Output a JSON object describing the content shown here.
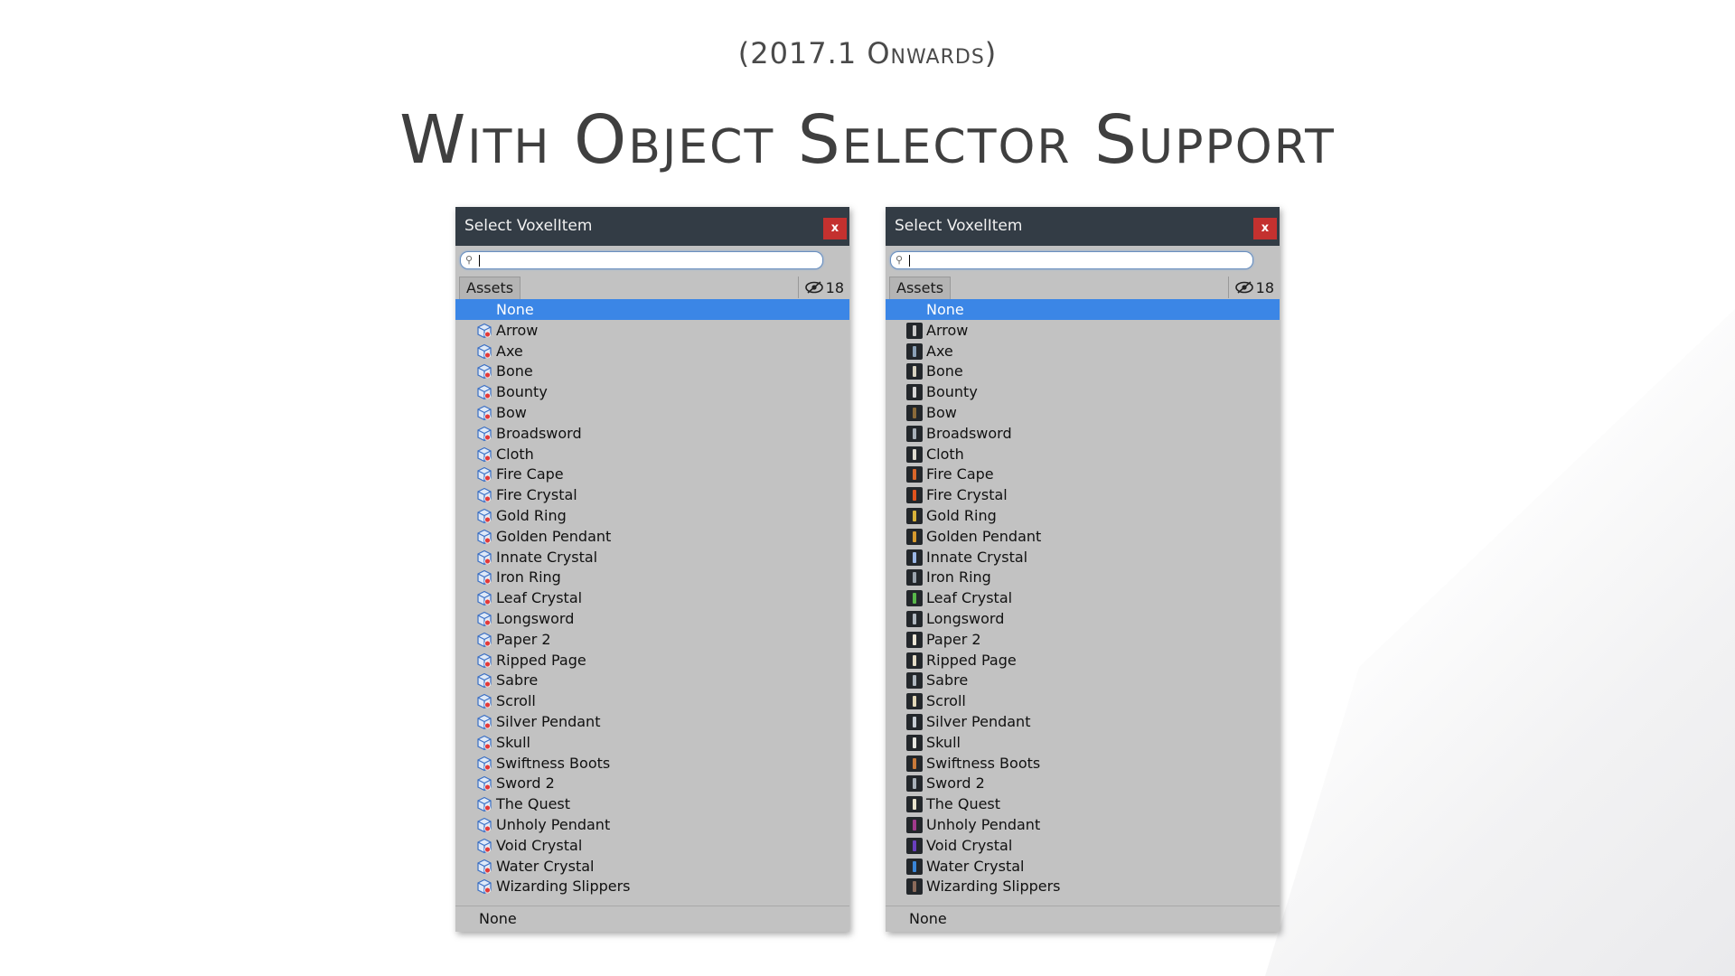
{
  "page": {
    "subtitle": "(2017.1 Onwards)",
    "title": "With Object Selector Support"
  },
  "colors": {
    "titlebar": "#333c45",
    "close_button": "#c4312f",
    "selection": "#3b86e6",
    "panel": "#c2c2c2"
  },
  "windows": [
    {
      "title": "Select VoxelItem",
      "close_label": "x",
      "search_value": "",
      "tab_label": "Assets",
      "hidden_count": "18",
      "icon_style": "prefab-cube-icon",
      "selected_label": "None"
    },
    {
      "title": "Select VoxelItem",
      "close_label": "x",
      "search_value": "",
      "tab_label": "Assets",
      "hidden_count": "18",
      "icon_style": "item-thumbnail-icon",
      "selected_label": "None"
    }
  ],
  "items": [
    {
      "label": "None",
      "thumb_color": ""
    },
    {
      "label": "Arrow",
      "thumb_color": "#c9c9c9"
    },
    {
      "label": "Axe",
      "thumb_color": "#8aa0b6"
    },
    {
      "label": "Bone",
      "thumb_color": "#d8d2c0"
    },
    {
      "label": "Bounty",
      "thumb_color": "#d6d6d6"
    },
    {
      "label": "Bow",
      "thumb_color": "#8a6a3a"
    },
    {
      "label": "Broadsword",
      "thumb_color": "#a8b0b8"
    },
    {
      "label": "Cloth",
      "thumb_color": "#e0dcd0"
    },
    {
      "label": "Fire Cape",
      "thumb_color": "#d9662a"
    },
    {
      "label": "Fire Crystal",
      "thumb_color": "#e0531e"
    },
    {
      "label": "Gold Ring",
      "thumb_color": "#d8b23a"
    },
    {
      "label": "Golden Pendant",
      "thumb_color": "#d69a2e"
    },
    {
      "label": "Innate Crystal",
      "thumb_color": "#9bb7e6"
    },
    {
      "label": "Iron Ring",
      "thumb_color": "#9aa3ad"
    },
    {
      "label": "Leaf Crystal",
      "thumb_color": "#58b84a"
    },
    {
      "label": "Longsword",
      "thumb_color": "#b0b8c0"
    },
    {
      "label": "Paper 2",
      "thumb_color": "#ece6d6"
    },
    {
      "label": "Ripped Page",
      "thumb_color": "#e4dcc6"
    },
    {
      "label": "Sabre",
      "thumb_color": "#aeb6be"
    },
    {
      "label": "Scroll",
      "thumb_color": "#e2d8b8"
    },
    {
      "label": "Silver Pendant",
      "thumb_color": "#c6ccd2"
    },
    {
      "label": "Skull",
      "thumb_color": "#e6e6e0"
    },
    {
      "label": "Swiftness Boots",
      "thumb_color": "#c87a3a"
    },
    {
      "label": "Sword 2",
      "thumb_color": "#a9b1b9"
    },
    {
      "label": "The Quest",
      "thumb_color": "#e8e2cc"
    },
    {
      "label": "Unholy Pendant",
      "thumb_color": "#a03a8c"
    },
    {
      "label": "Void Crystal",
      "thumb_color": "#6a3fbf"
    },
    {
      "label": "Water Crystal",
      "thumb_color": "#3a86d8"
    },
    {
      "label": "Wizarding Slippers",
      "thumb_color": "#8a6a5a"
    }
  ]
}
